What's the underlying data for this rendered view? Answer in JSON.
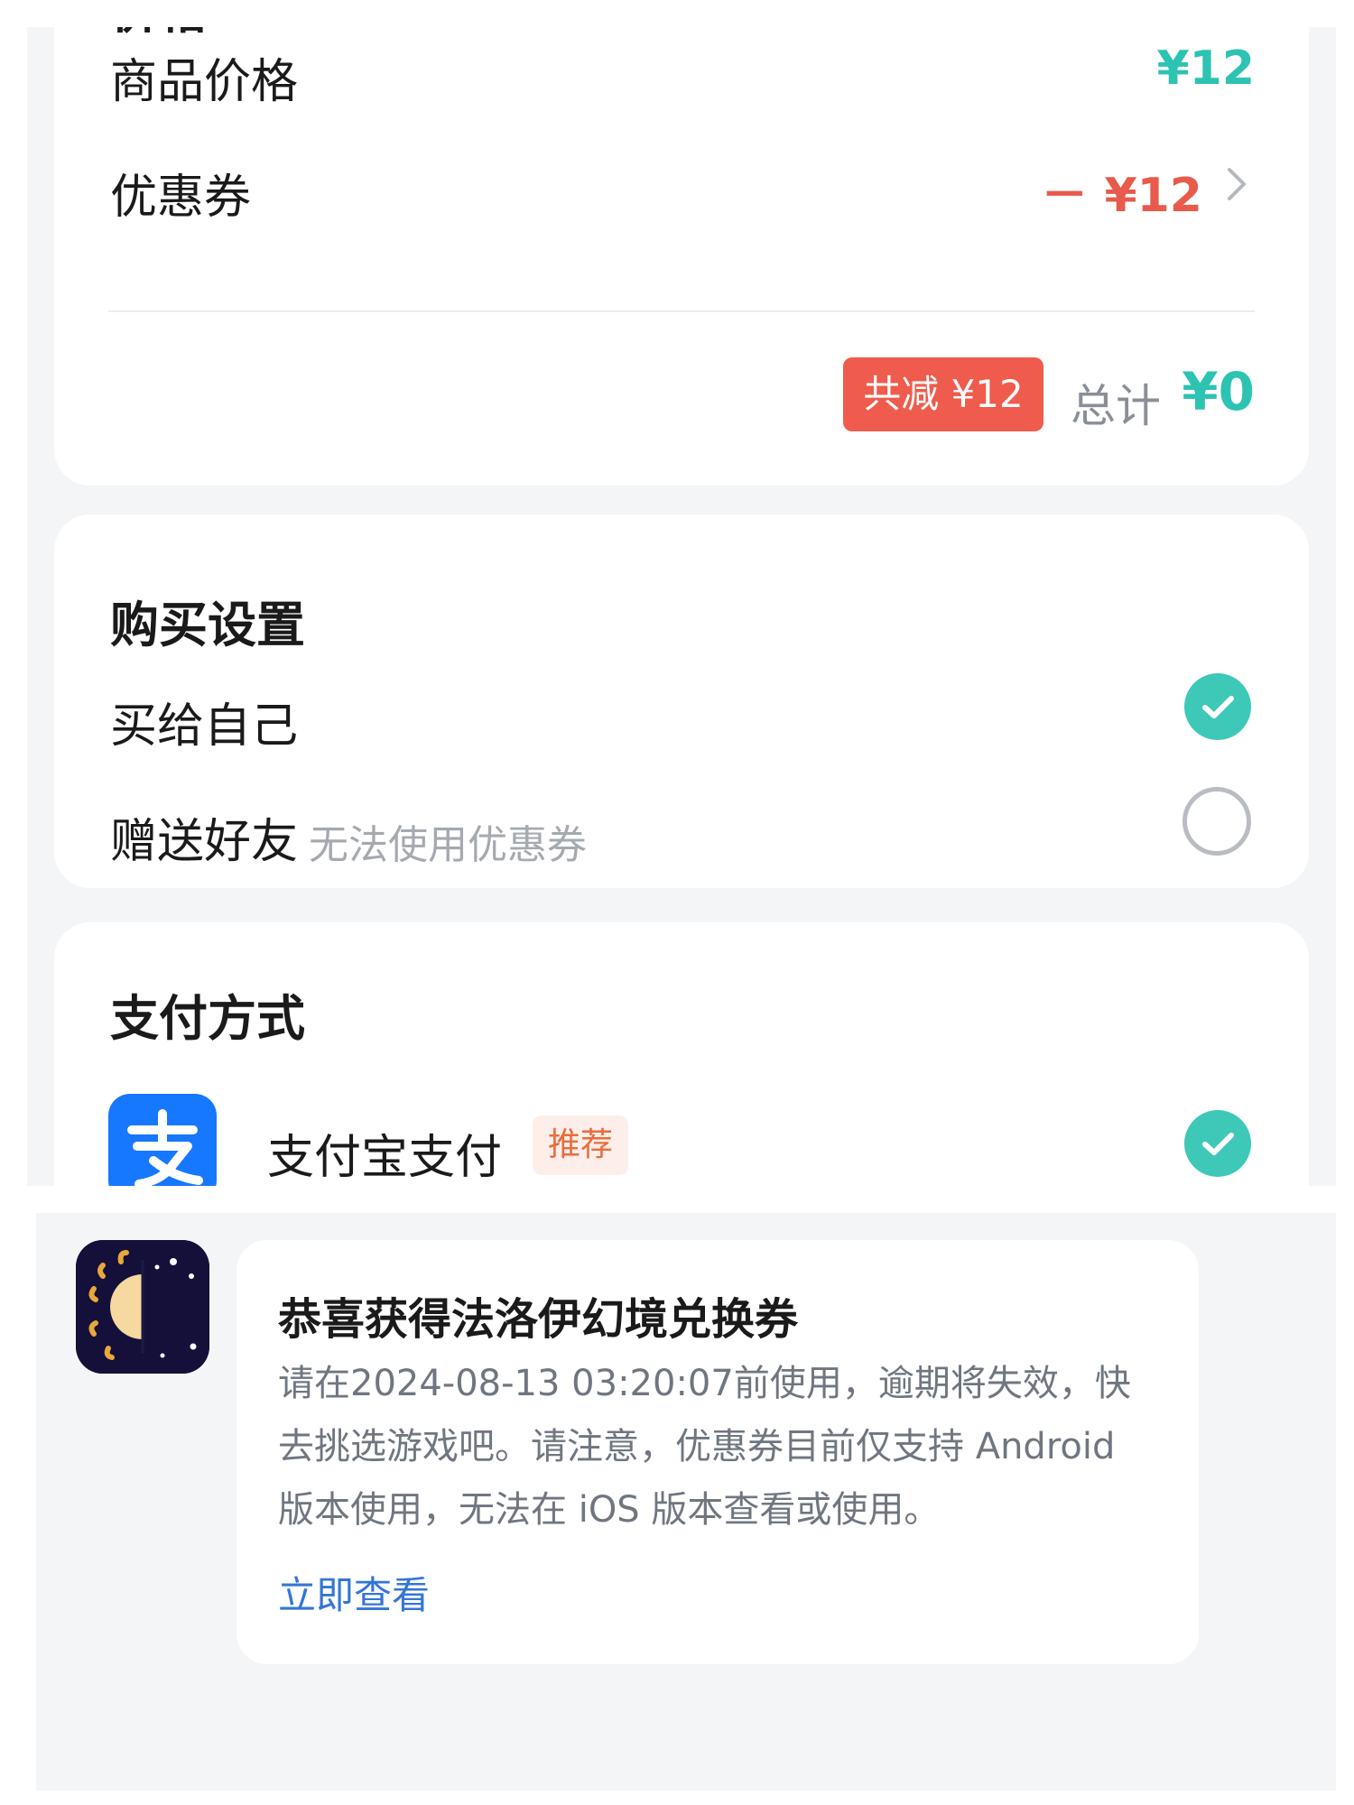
{
  "colors": {
    "accent_teal": "#2dc3b3",
    "discount_red": "#e85a4c",
    "badge_red": "#ef5b4c",
    "check_teal": "#3ec8b8",
    "link_blue": "#3475d6",
    "alipay_blue": "#1677ff",
    "page_bg": "#f4f5f7"
  },
  "price_section": {
    "title_partial": "价格",
    "goods_price_label": "商品价格",
    "goods_price_value": "¥12",
    "coupon_label": "优惠券",
    "coupon_value": "－ ¥12",
    "coupon_chevron_icon": "chevron-right-icon",
    "discount_badge": "共减 ¥12",
    "total_label": "总计",
    "total_value": "¥0"
  },
  "purchase_settings": {
    "title": "购买设置",
    "options": [
      {
        "label": "买给自己",
        "selected": true
      },
      {
        "label": "赠送好友",
        "note": "无法使用优惠券",
        "selected": false
      }
    ]
  },
  "payment": {
    "title": "支付方式",
    "methods": [
      {
        "label": "支付宝支付",
        "badge": "推荐",
        "icon": "alipay-icon",
        "selected": true
      }
    ]
  },
  "notification": {
    "icon": "game-app-icon",
    "title": "恭喜获得法洛伊幻境兑换券",
    "body": "请在2024-08-13 03:20:07前使用，逾期将失效，快去挑选游戏吧。请注意，优惠券目前仅支持 Android 版本使用，无法在 iOS 版本查看或使用。",
    "link": "立即查看"
  }
}
